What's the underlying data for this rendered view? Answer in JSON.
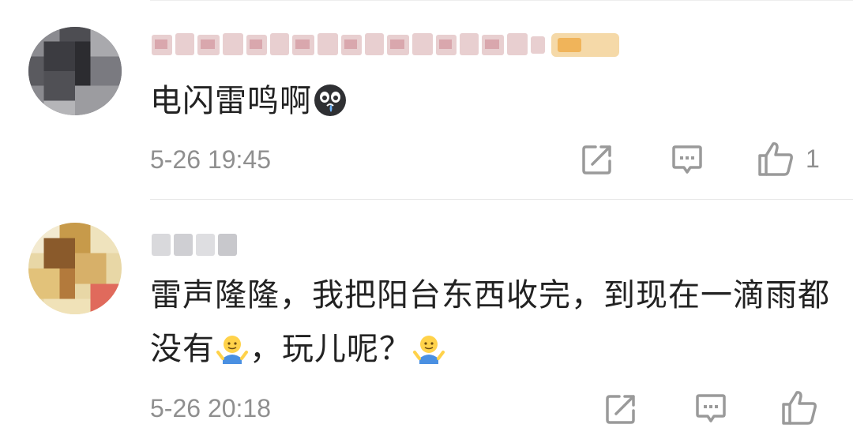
{
  "comments": [
    {
      "avatar": "pixelated-avatar-gray",
      "username_icon": "pixelated-username",
      "text": "电闪雷鸣啊",
      "emoji": "crying-face-icon",
      "timestamp": "5-26 19:45",
      "actions": {
        "share_icon": "share-icon",
        "reply_icon": "comment-icon",
        "like_icon": "thumbs-up-icon",
        "like_count": "1"
      }
    },
    {
      "avatar": "pixelated-avatar-yellow",
      "username_icon": "pixelated-username",
      "text_part1": "雷声隆隆，我把阳台东西收完，到现在一滴雨都没有",
      "text_part2": "，玩儿呢？",
      "emoji": "shrug-icon",
      "timestamp": "5-26 20:18",
      "actions": {
        "share_icon": "share-icon",
        "reply_icon": "comment-icon",
        "like_icon": "thumbs-up-icon",
        "like_count": ""
      }
    }
  ],
  "colors": {
    "text": "#222222",
    "meta": "#8f8f8f",
    "icon": "#9a9a9a",
    "divider": "#e8e8e8"
  }
}
